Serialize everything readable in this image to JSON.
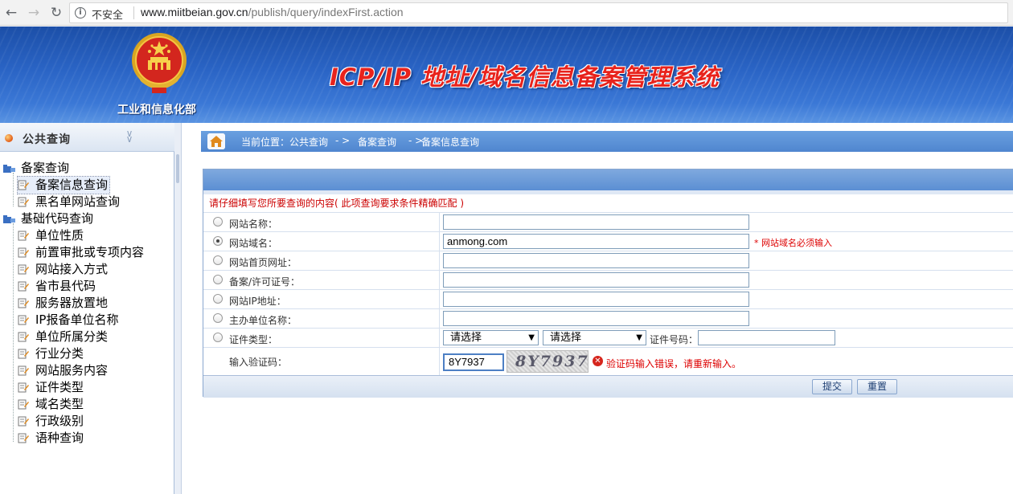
{
  "browser": {
    "back_icon": "back-arrow-icon",
    "forward_icon": "forward-arrow-icon",
    "reload_icon": "reload-icon",
    "security_label": "不安全",
    "url_host": "www.miitbeian.gov.cn",
    "url_path": "/publish/query/indexFirst.action"
  },
  "banner": {
    "ministry": "工业和信息化部",
    "title": "ICP/IP 地址/域名信息备案管理系统",
    "colors": {
      "bg": "#2a64c5",
      "title": "#e8231c"
    }
  },
  "sidebar": {
    "title": "公共查询",
    "groups": [
      {
        "label": "备案查询",
        "items": [
          "备案信息查询",
          "黑名单网站查询"
        ]
      },
      {
        "label": "基础代码查询",
        "items": [
          "单位性质",
          "前置审批或专项内容",
          "网站接入方式",
          "省市县代码",
          "服务器放置地",
          "IP报备单位名称",
          "单位所属分类",
          "行业分类",
          "网站服务内容",
          "证件类型",
          "域名类型",
          "行政级别",
          "语种查询"
        ]
      }
    ],
    "selected": "备案信息查询"
  },
  "breadcrumb": {
    "prefix": "当前位置：公共查询",
    "sep1": "- >",
    "level2": "备案查询",
    "sep2": "- >",
    "level3": "备案信息查询"
  },
  "form": {
    "hint": "请仔细填写您所要查询的内容( 此项查询要求条件精确匹配 )",
    "fields": [
      {
        "label": "网站名称：",
        "value": "",
        "checked": false
      },
      {
        "label": "网站域名：",
        "value": "anmong.com",
        "checked": true,
        "required_note": "* 网站域名必须输入"
      },
      {
        "label": "网站首页网址：",
        "value": "",
        "checked": false
      },
      {
        "label": "备案/许可证号：",
        "value": "",
        "checked": false
      },
      {
        "label": "网站IP地址：",
        "value": "",
        "checked": false
      },
      {
        "label": "主办单位名称：",
        "value": "",
        "checked": false
      }
    ],
    "cert": {
      "label": "证件类型：",
      "select1": "请选择",
      "select2": "请选择",
      "number_label": "证件号码："
    },
    "captcha": {
      "label": "输入验证码：",
      "value": "8Y7937",
      "image_text": "8Y7937",
      "error": "验证码输入错误，请重新输入。"
    },
    "buttons": {
      "submit": "提交",
      "reset": "重置"
    }
  }
}
